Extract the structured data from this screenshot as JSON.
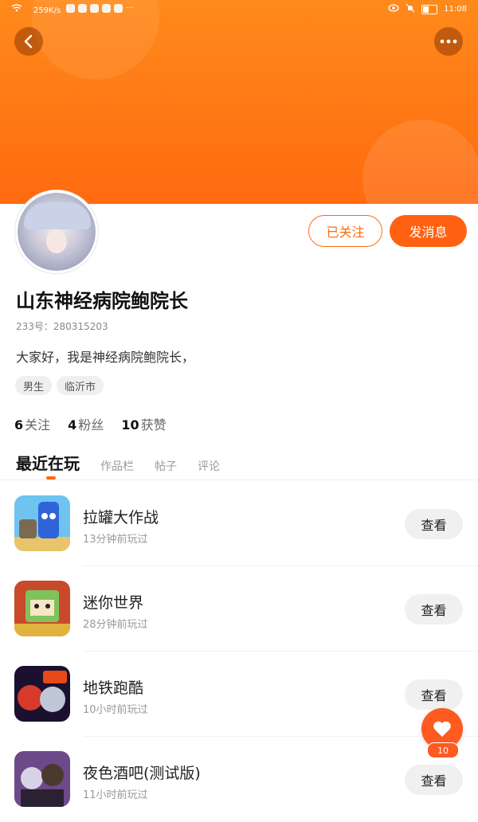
{
  "status_bar": {
    "net_speed": "259K/s",
    "time": "11:08"
  },
  "header": {
    "back_icon": "chevron-left-icon",
    "more_icon": "more-dots-icon"
  },
  "profile": {
    "name": "山东神经病院鲍院长",
    "uid": "233号：280315203",
    "bio": "大家好，我是神经病院鲍院长，",
    "tags": [
      "男生",
      "临沂市"
    ],
    "following_btn": "已关注",
    "message_btn": "发消息",
    "stats": [
      {
        "count": "6",
        "label": "关注"
      },
      {
        "count": "4",
        "label": "粉丝"
      },
      {
        "count": "10",
        "label": "获赞"
      }
    ]
  },
  "tabs": [
    {
      "label": "最近在玩",
      "active": true
    },
    {
      "label": "作品栏",
      "active": false
    },
    {
      "label": "帖子",
      "active": false
    },
    {
      "label": "评论",
      "active": false
    }
  ],
  "games": [
    {
      "title": "拉罐大作战",
      "time": "13分钟前玩过",
      "action": "查看"
    },
    {
      "title": "迷你世界",
      "time": "28分钟前玩过",
      "action": "查看"
    },
    {
      "title": "地铁跑酷",
      "time": "10小时前玩过",
      "action": "查看"
    },
    {
      "title": "夜色酒吧(测试版)",
      "time": "11小时前玩过",
      "action": "查看"
    }
  ],
  "like_fab": {
    "icon": "heart-icon",
    "count": "10"
  },
  "colors": {
    "accent": "#ff6a10",
    "header_gradient_top": "#ff8a1b",
    "header_gradient_bottom": "#ff6a10"
  }
}
